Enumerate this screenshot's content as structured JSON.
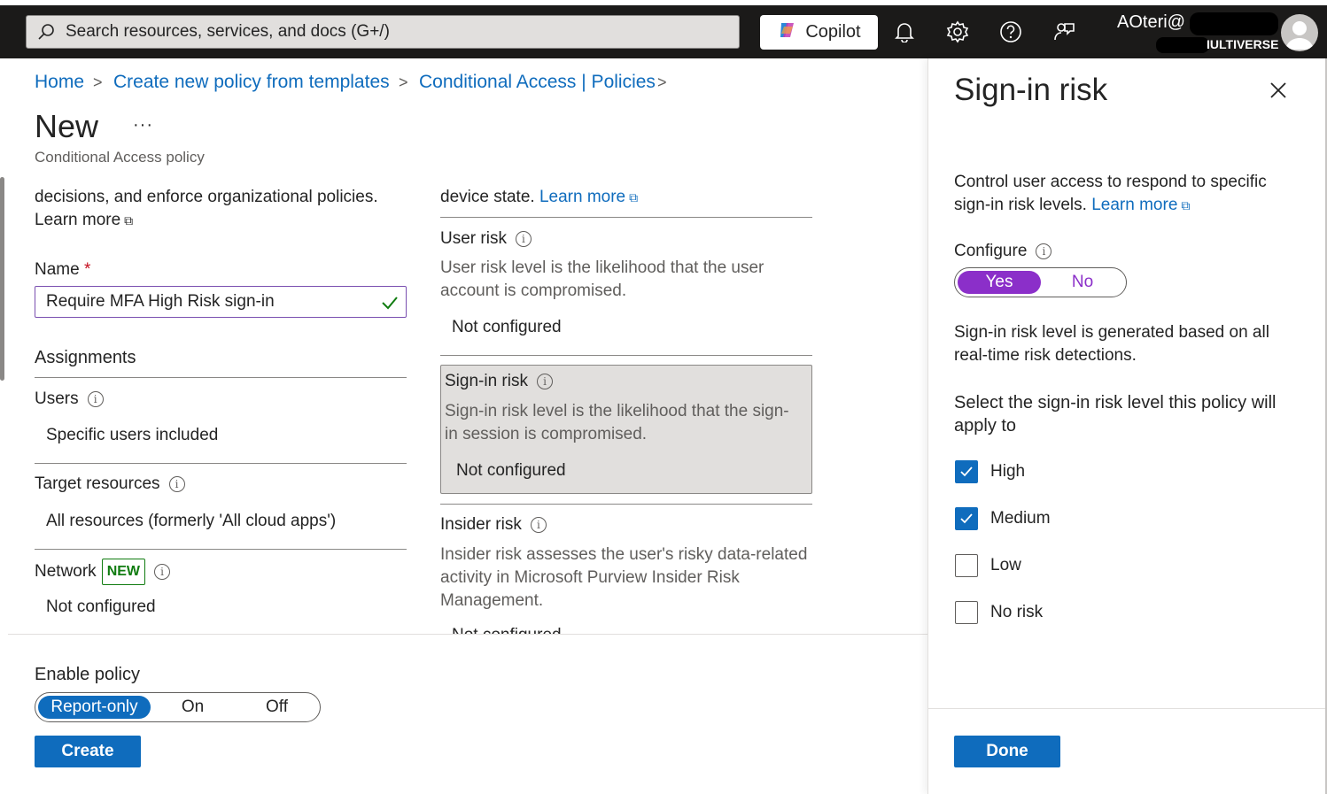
{
  "topbar": {
    "search_placeholder": "Search resources, services, and docs (G+/)",
    "copilot_label": "Copilot",
    "account_name": "AOteri@",
    "account_org": "IULTIVERSE"
  },
  "breadcrumb": [
    "Home",
    "Create new policy from templates",
    "Conditional Access | Policies"
  ],
  "page": {
    "title": "New",
    "more": "···",
    "subtitle": "Conditional Access policy"
  },
  "left": {
    "intro_partial": "decisions, and enforce organizational policies.",
    "learn_more": "Learn more",
    "name_label": "Name",
    "required_mark": "*",
    "name_value": "Require MFA High Risk sign-in",
    "assignments_heading": "Assignments",
    "users_label": "Users",
    "users_value": "Specific users included",
    "target_label": "Target resources",
    "target_value": "All resources (formerly 'All cloud apps')",
    "network_label": "Network",
    "network_badge": "NEW",
    "network_value": "Not configured"
  },
  "conditions": {
    "intro_partial": "device state.",
    "learn_more": "Learn more",
    "user_risk_label": "User risk",
    "user_risk_desc": "User risk level is the likelihood that the user account is compromised.",
    "user_risk_value": "Not configured",
    "signin_risk_label": "Sign-in risk",
    "signin_risk_desc": "Sign-in risk level is the likelihood that the sign-in session is compromised.",
    "signin_risk_value": "Not configured",
    "insider_risk_label": "Insider risk",
    "insider_risk_desc": "Insider risk assesses the user's risky data-related activity in Microsoft Purview Insider Risk Management.",
    "insider_risk_value_partial": "Not configured"
  },
  "footer": {
    "enable_label": "Enable policy",
    "options": [
      "Report-only",
      "On",
      "Off"
    ],
    "selected": "Report-only",
    "create_label": "Create"
  },
  "panel": {
    "title": "Sign-in risk",
    "description": "Control user access to respond to specific sign-in risk levels.",
    "learn_more": "Learn more",
    "configure_label": "Configure",
    "configure_yes": "Yes",
    "configure_no": "No",
    "configure_selected": "Yes",
    "generated_text": "Sign-in risk level is generated based on all real-time risk detections.",
    "select_text": "Select the sign-in risk level this policy will apply to",
    "levels": [
      {
        "label": "High",
        "checked": true
      },
      {
        "label": "Medium",
        "checked": true
      },
      {
        "label": "Low",
        "checked": false
      },
      {
        "label": "No risk",
        "checked": false
      }
    ],
    "done_label": "Done"
  },
  "colors": {
    "accent": "#0f6cbd",
    "toggle_purple": "#8b2fc9",
    "badge_green": "#107c10",
    "topbar": "#1b1a19"
  }
}
